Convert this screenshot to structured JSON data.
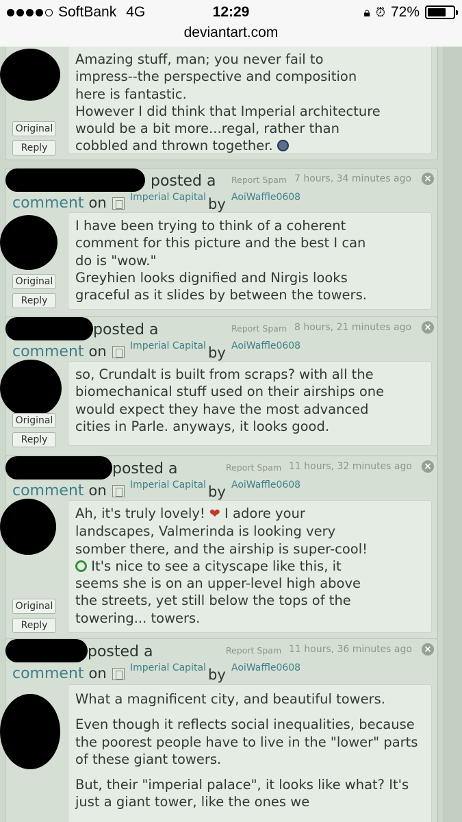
{
  "status_bar": {
    "carrier": "SoftBank",
    "network": "4G",
    "time": "12:29",
    "battery_text": "72%",
    "battery_level": 0.72
  },
  "url": "deviantart.com",
  "first_comment": {
    "original_label": "Original",
    "reply_label": "Reply",
    "lines": [
      "Amazing stuff, man; you never fail to",
      "impress--the perspective and composition",
      "here is fantastic.",
      "However I did think that Imperial architecture",
      "would be a bit more...regal, rather than",
      "cobbled and thrown together."
    ]
  },
  "comments": [
    {
      "posted": "posted a",
      "comment_word": "comment",
      "on_word": "on",
      "deviation": "Imperial Capital",
      "by_word": "by",
      "author": "AoiWaffle0608",
      "report": "Report Spam",
      "time": "7 hours, 34 minutes ago",
      "original_label": "Original",
      "reply_label": "Reply",
      "lines": [
        "I have been trying to think of a coherent",
        "comment for this picture and the best I can",
        "do is \"wow.\"",
        "Greyhien looks dignified and Nirgis looks",
        "graceful as it slides by between the towers."
      ]
    },
    {
      "posted": "posted a",
      "comment_word": "comment",
      "on_word": "on",
      "deviation": "Imperial Capital",
      "by_word": "by",
      "author": "AoiWaffle0608",
      "report": "Report Spam",
      "time": "8 hours, 21 minutes ago",
      "original_label": "Original",
      "reply_label": "Reply",
      "lines": [
        "so, Crundalt is built from scraps? with all the",
        "biomechanical stuff used on their airships one",
        "would expect they have the most advanced",
        "cities in Parle. anyways, it looks good."
      ]
    },
    {
      "posted": "posted a",
      "comment_word": "comment",
      "on_word": "on",
      "deviation": "Imperial Capital",
      "by_word": "by",
      "author": "AoiWaffle0608",
      "report": "Report Spam",
      "time": "11 hours, 32 minutes ago",
      "original_label": "Original",
      "reply_label": "Reply",
      "lines": [
        "Ah, it's truly lovely!",
        "I adore your",
        "landscapes, Valmerinda is looking very",
        "somber there, and the airship is super-cool!",
        "It's nice to see a cityscape like this, it",
        "seems she is on an upper-level high above",
        "the streets, yet still below the tops of the",
        "towering... towers."
      ]
    },
    {
      "posted": "posted a",
      "comment_word": "comment",
      "on_word": "on",
      "deviation": "Imperial Capital",
      "by_word": "by",
      "author": "AoiWaffle0608",
      "report": "Report Spam",
      "time": "11 hours, 36 minutes ago",
      "paragraphs": [
        "What a magnificent city, and beautiful towers.",
        "Even though it reflects social inequalities, because the poorest people have to live in the \"lower\" parts of these giant towers.",
        "But, their \"imperial palace\", it looks like what? It's just a giant tower, like the ones we"
      ]
    }
  ]
}
